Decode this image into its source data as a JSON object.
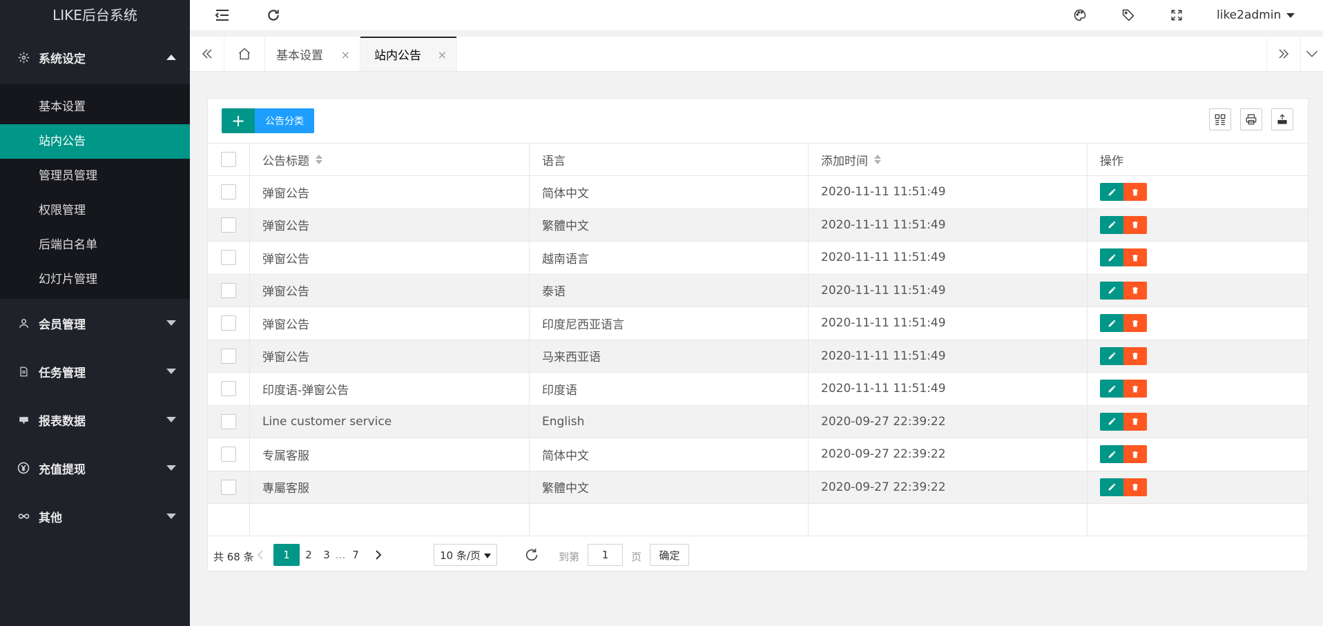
{
  "app": {
    "title": "LIKE后台系统"
  },
  "sidebar": {
    "groups": [
      {
        "label": "系统设定",
        "icon": "gear-icon",
        "expanded": true,
        "items": [
          {
            "label": "基本设置"
          },
          {
            "label": "站内公告",
            "active": true
          },
          {
            "label": "管理员管理"
          },
          {
            "label": "权限管理"
          },
          {
            "label": "后端白名单"
          },
          {
            "label": "幻灯片管理"
          }
        ]
      },
      {
        "label": "会员管理",
        "icon": "user-icon"
      },
      {
        "label": "任务管理",
        "icon": "document-icon"
      },
      {
        "label": "报表数据",
        "icon": "monitor-icon"
      },
      {
        "label": "充值提现",
        "icon": "yen-icon"
      },
      {
        "label": "其他",
        "icon": "infinity-icon"
      }
    ]
  },
  "header": {
    "username": "like2admin",
    "icons": [
      "menu-fold-icon",
      "refresh-icon",
      "palette-icon",
      "tag-icon",
      "fullscreen-icon"
    ]
  },
  "tabs": [
    {
      "label": "基本设置"
    },
    {
      "label": "站内公告",
      "active": true
    }
  ],
  "toolbar": {
    "add_label": "+",
    "category_label": "公告分类"
  },
  "table": {
    "columns": [
      "公告标题",
      "语言",
      "添加时间",
      "操作"
    ],
    "rows": [
      {
        "title": "弹窗公告",
        "lang": "简体中文",
        "time": "2020-11-11 11:51:49"
      },
      {
        "title": "弹窗公告",
        "lang": "繁體中文",
        "time": "2020-11-11 11:51:49"
      },
      {
        "title": "弹窗公告",
        "lang": "越南语言",
        "time": "2020-11-11 11:51:49"
      },
      {
        "title": "弹窗公告",
        "lang": "泰语",
        "time": "2020-11-11 11:51:49"
      },
      {
        "title": "弹窗公告",
        "lang": "印度尼西亚语言",
        "time": "2020-11-11 11:51:49"
      },
      {
        "title": "弹窗公告",
        "lang": "马来西亚语",
        "time": "2020-11-11 11:51:49"
      },
      {
        "title": "印度语-弹窗公告",
        "lang": "印度语",
        "time": "2020-11-11 11:51:49"
      },
      {
        "title": "Line customer service",
        "lang": "English",
        "time": "2020-09-27 22:39:22"
      },
      {
        "title": "专属客服",
        "lang": "简体中文",
        "time": "2020-09-27 22:39:22"
      },
      {
        "title": "專屬客服",
        "lang": "繁體中文",
        "time": "2020-09-27 22:39:22"
      }
    ]
  },
  "pagination": {
    "total_label": "共 68 条",
    "pages": [
      "1",
      "2",
      "3",
      "…",
      "7"
    ],
    "current": "1",
    "per_page": "10 条/页",
    "goto_label": "到第",
    "goto_value": "1",
    "page_unit": "页",
    "confirm_label": "确定"
  },
  "colors": {
    "primary": "#009688",
    "blue": "#1e9fff",
    "danger": "#ff5722",
    "sidebar": "#20222a"
  }
}
